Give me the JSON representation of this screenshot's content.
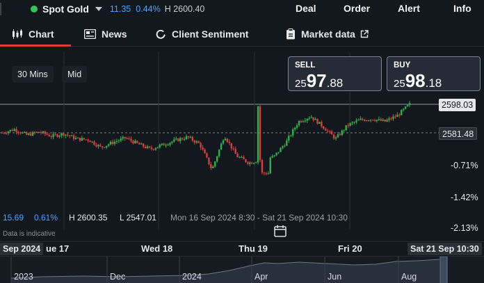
{
  "header": {
    "symbol": "Spot Gold",
    "change": "11.35",
    "change_pct": "0.44%",
    "high": "H 2600.40",
    "nav": [
      "Deal",
      "Order",
      "Alert",
      "Info"
    ],
    "status_color": "#39c25a",
    "accent": "#4aa3ff"
  },
  "tabs": [
    {
      "label": "Chart",
      "icon": "candles-icon",
      "active": true
    },
    {
      "label": "News",
      "icon": "newspaper-icon"
    },
    {
      "label": "Client Sentiment",
      "icon": "refresh-icon"
    },
    {
      "label": "Market data",
      "icon": "clipboard-icon",
      "external_icon": "external-link-icon"
    }
  ],
  "toolbar": {
    "interval": "30 Mins",
    "price_type": "Mid"
  },
  "quotes": {
    "sell": {
      "label": "SELL",
      "a": "25",
      "b": "97",
      "c": ".88"
    },
    "buy": {
      "label": "BUY",
      "a": "25",
      "b": "98",
      "c": ".18"
    }
  },
  "price_axis": {
    "current": "2598.03",
    "reference": "2581.48",
    "pct_labels": [
      "-0.71%",
      "-1.42%",
      "-2.13%"
    ]
  },
  "stats": {
    "change": "15.69",
    "change_pct": "0.61%",
    "high": "H 2600.35",
    "low": "L 2547.01",
    "range": "Mon 16 Sep 2024 8:30 - Sat 21 Sep 2024 10:30",
    "note": "Data is indicative"
  },
  "time_axis": {
    "left_box": "Sep 2024",
    "labels": [
      "ue 17",
      "Wed 18",
      "Thu 19",
      "Fri 20"
    ],
    "right_box": "Sat 21 Sep 10:30"
  },
  "navigator": {
    "labels": [
      "2023",
      "Dec",
      "2024",
      "Apr",
      "Jun",
      "Aug"
    ]
  },
  "colors": {
    "up": "#30b24a",
    "down": "#e23b3b",
    "bg": "#13171e",
    "tab_underline": "#e23b3b"
  },
  "chart_data": {
    "type": "candlestick",
    "y_unit": "USD",
    "points_approx": [
      2581.5,
      2583.5,
      2580.2,
      2582.0,
      2579.5,
      2581.0,
      2578.0,
      2577.5,
      2573.0,
      2576.0,
      2578.5,
      2575.0,
      2572.0,
      2574.5,
      2577.0,
      2579.0,
      2575.0,
      2560.0,
      2580.0,
      2568.0,
      2564.0,
      2566.0,
      2567.5,
      2576.0,
      2588.0,
      2591.0,
      2585.0,
      2578.0,
      2586.0,
      2589.0,
      2589.5,
      2588.0,
      2591.5,
      2598.0
    ],
    "current": 2598.03,
    "reference": 2581.48,
    "high": 2600.35,
    "low": 2547.01
  }
}
